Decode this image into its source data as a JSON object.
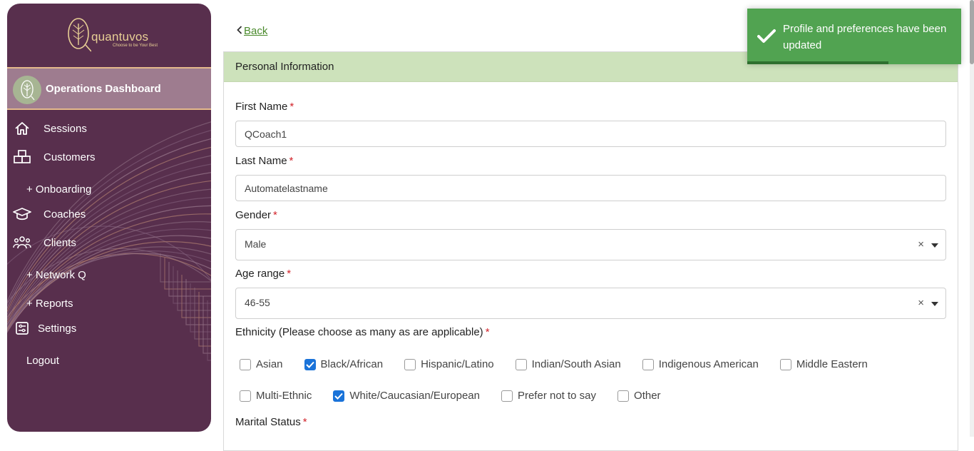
{
  "brand": {
    "name": "quantuvos",
    "tagline": "Choose to be Your Best",
    "color": "#582f4d",
    "accent": "#e4b98b"
  },
  "sidebar": {
    "dashboard_title": "Operations Dashboard",
    "items": [
      {
        "label": "Sessions",
        "icon": "home-icon"
      },
      {
        "label": "Customers",
        "icon": "boxes-icon"
      },
      {
        "label": "+ Onboarding",
        "icon": ""
      },
      {
        "label": "Coaches",
        "icon": "graduation-cap-icon"
      },
      {
        "label": "Clients",
        "icon": "users-icon"
      },
      {
        "label": "+ Network Q",
        "icon": ""
      },
      {
        "label": "+ Reports",
        "icon": ""
      },
      {
        "label": "Settings",
        "icon": "settings-panel-icon"
      },
      {
        "label": "Logout",
        "icon": ""
      }
    ]
  },
  "main": {
    "back_label": "Back",
    "section_title": "Personal Information",
    "first_name": {
      "label": "First Name",
      "value": "QCoach1"
    },
    "last_name": {
      "label": "Last Name",
      "value": "Automatelastname"
    },
    "gender": {
      "label": "Gender",
      "value": "Male"
    },
    "age_range": {
      "label": "Age range",
      "value": "46-55"
    },
    "ethnicity": {
      "label": "Ethnicity (Please choose as many as are applicable)",
      "options": [
        {
          "label": "Asian",
          "checked": false
        },
        {
          "label": "Black/African",
          "checked": true
        },
        {
          "label": "Hispanic/Latino",
          "checked": false
        },
        {
          "label": "Indian/South Asian",
          "checked": false
        },
        {
          "label": "Indigenous American",
          "checked": false
        },
        {
          "label": "Middle Eastern",
          "checked": false
        },
        {
          "label": "Multi-Ethnic",
          "checked": false
        },
        {
          "label": "White/Caucasian/European",
          "checked": true
        },
        {
          "label": "Prefer not to say",
          "checked": false
        },
        {
          "label": "Other",
          "checked": false
        }
      ]
    },
    "marital_status": {
      "label": "Marital Status"
    },
    "required_mark": "*",
    "clear_glyph": "×"
  },
  "toast": {
    "message": "Profile and preferences have been updated",
    "color": "#51a351",
    "progress": 0.66
  }
}
